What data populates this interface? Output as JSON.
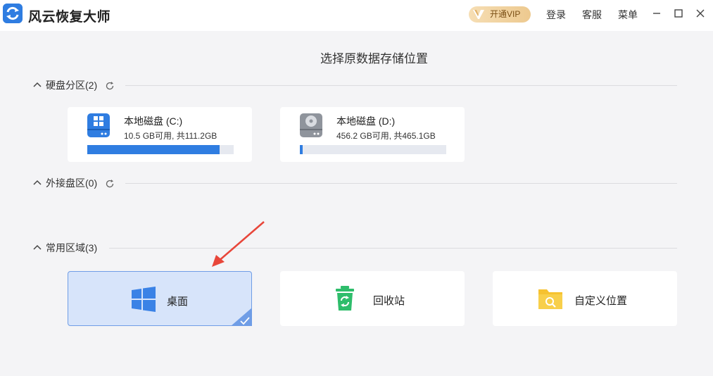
{
  "app": {
    "title": "风云恢复大师",
    "logo_icon": "app-logo-icon"
  },
  "topbar": {
    "vip_label": "开通VIP",
    "login_label": "登录",
    "service_label": "客服",
    "menu_label": "菜单",
    "window_controls": [
      "minimize-icon",
      "maximize-icon",
      "close-icon"
    ]
  },
  "page": {
    "title": "选择原数据存储位置"
  },
  "sections": {
    "disk": {
      "label": "硬盘分区(2)"
    },
    "external": {
      "label": "外接盘区(0)"
    },
    "common": {
      "label": "常用区域(3)"
    }
  },
  "drives": [
    {
      "name": "本地磁盘 (C:)",
      "size": "10.5 GB可用, 共111.2GB",
      "used_fraction": 0.906,
      "icon": "windows-drive-icon"
    },
    {
      "name": "本地磁盘 (D:)",
      "size": "456.2 GB可用, 共465.1GB",
      "used_fraction": 0.019,
      "icon": "hard-drive-icon"
    }
  ],
  "locations": [
    {
      "label": "桌面",
      "icon": "windows-icon",
      "selected": true
    },
    {
      "label": "回收站",
      "icon": "recycle-bin-icon",
      "selected": false
    },
    {
      "label": "自定义位置",
      "icon": "folder-search-icon",
      "selected": false
    }
  ],
  "colors": {
    "accent": "#2f7de1",
    "selected_bg": "#d7e4fa",
    "selected_border": "#6f9de6",
    "vip_gold": "#edc98f",
    "recycle_green": "#2ebd6b",
    "folder_yellow": "#f6c230",
    "arrow_red": "#e8463a"
  }
}
